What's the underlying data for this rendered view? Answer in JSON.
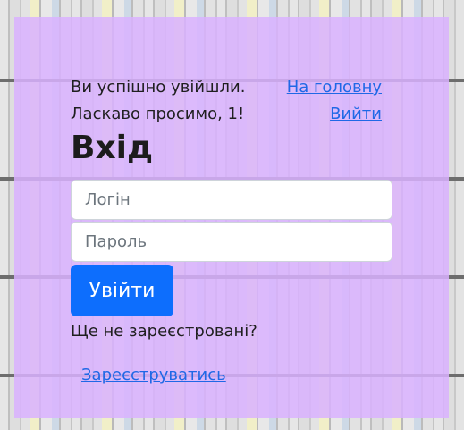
{
  "status": {
    "logged_in_text": "Ви успішно увійшли.",
    "home_link": "На головну",
    "welcome_text": "Ласкаво просимо, 1!",
    "logout_link": "Вийти"
  },
  "form": {
    "title": "Вхід",
    "login_placeholder": "Логін",
    "login_value": "",
    "password_placeholder": "Пароль",
    "password_value": "",
    "submit_label": "Увійти"
  },
  "register": {
    "question": "Ще не зареєстровані?",
    "link": "Зареєструватись"
  },
  "colors": {
    "panel": "#d9b2ff",
    "primary": "#0d6efd",
    "link": "#1f68e6"
  }
}
